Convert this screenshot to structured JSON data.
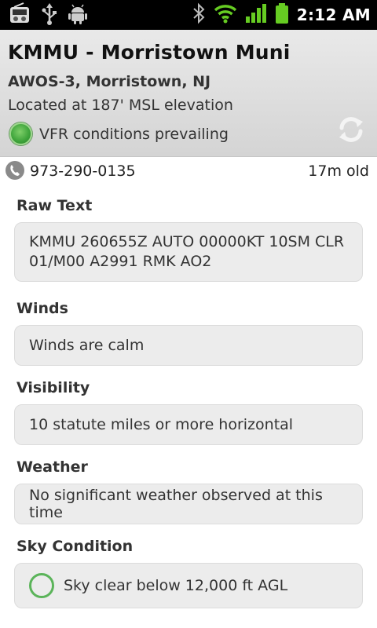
{
  "status_bar": {
    "time": "2:12 AM",
    "left_icons": [
      "radio-icon",
      "usb-icon",
      "android-icon"
    ],
    "right_icons": [
      "bluetooth-icon",
      "wifi-icon",
      "signal-icon",
      "battery-icon"
    ]
  },
  "header": {
    "title": "KMMU - Morristown Muni",
    "subtitle": "AWOS-3, Morristown, NJ",
    "elevation": "Located at 187' MSL elevation",
    "flight_category": "VFR conditions prevailing",
    "flight_category_color": "#3da33a"
  },
  "contact": {
    "phone": "973-290-0135",
    "age": "17m old"
  },
  "sections": {
    "raw_text": {
      "label": "Raw Text",
      "line1": "KMMU 260655Z AUTO 00000KT 10SM CLR",
      "line2": "01/M00 A2991 RMK AO2"
    },
    "winds": {
      "label": "Winds",
      "value": "Winds are calm"
    },
    "visibility": {
      "label": "Visibility",
      "value": "10 statute miles or more horizontal"
    },
    "weather": {
      "label": "Weather",
      "value": "No significant weather observed at this time"
    },
    "sky": {
      "label": "Sky Condition",
      "value": "Sky clear below 12,000 ft AGL"
    }
  }
}
